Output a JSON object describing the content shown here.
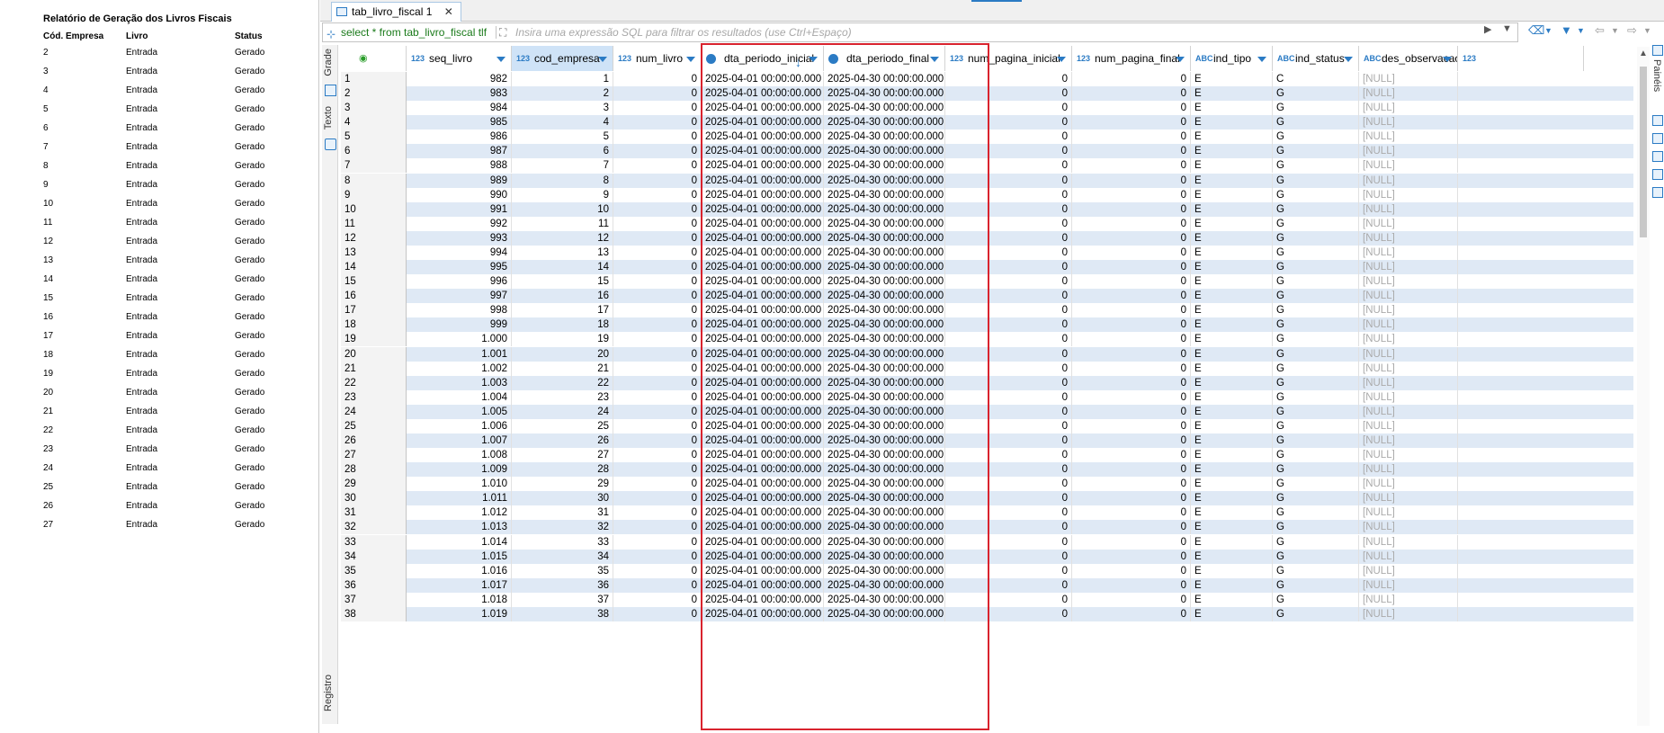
{
  "report": {
    "title": "Relatório de Geração dos Livros Fiscais",
    "headers": [
      "Cód. Empresa",
      "Livro",
      "Status"
    ],
    "rows": [
      [
        "2",
        "Entrada",
        "Gerado"
      ],
      [
        "3",
        "Entrada",
        "Gerado"
      ],
      [
        "4",
        "Entrada",
        "Gerado"
      ],
      [
        "5",
        "Entrada",
        "Gerado"
      ],
      [
        "6",
        "Entrada",
        "Gerado"
      ],
      [
        "7",
        "Entrada",
        "Gerado"
      ],
      [
        "8",
        "Entrada",
        "Gerado"
      ],
      [
        "9",
        "Entrada",
        "Gerado"
      ],
      [
        "10",
        "Entrada",
        "Gerado"
      ],
      [
        "11",
        "Entrada",
        "Gerado"
      ],
      [
        "12",
        "Entrada",
        "Gerado"
      ],
      [
        "13",
        "Entrada",
        "Gerado"
      ],
      [
        "14",
        "Entrada",
        "Gerado"
      ],
      [
        "15",
        "Entrada",
        "Gerado"
      ],
      [
        "16",
        "Entrada",
        "Gerado"
      ],
      [
        "17",
        "Entrada",
        "Gerado"
      ],
      [
        "18",
        "Entrada",
        "Gerado"
      ],
      [
        "19",
        "Entrada",
        "Gerado"
      ],
      [
        "20",
        "Entrada",
        "Gerado"
      ],
      [
        "21",
        "Entrada",
        "Gerado"
      ],
      [
        "22",
        "Entrada",
        "Gerado"
      ],
      [
        "23",
        "Entrada",
        "Gerado"
      ],
      [
        "24",
        "Entrada",
        "Gerado"
      ],
      [
        "25",
        "Entrada",
        "Gerado"
      ],
      [
        "26",
        "Entrada",
        "Gerado"
      ],
      [
        "27",
        "Entrada",
        "Gerado"
      ]
    ]
  },
  "editor": {
    "tab_label": "tab_livro_fiscal 1",
    "tab_close": "✕",
    "filter_sql": "select * from tab_livro_fiscal tlf",
    "filter_placeholder": "Insira uma expressão SQL para filtrar os resultados (use Ctrl+Espaço)",
    "side_labels": {
      "grid": "Grade",
      "text": "Texto",
      "record": "Registro"
    },
    "right_panel_label": "Painéis"
  },
  "columns": [
    {
      "name": "seq_livro",
      "type": "123"
    },
    {
      "name": "cod_empresa",
      "type": "123"
    },
    {
      "name": "num_livro",
      "type": "123"
    },
    {
      "name": "dta_periodo_inicial",
      "type": "clock"
    },
    {
      "name": "dta_periodo_final",
      "type": "clock"
    },
    {
      "name": "num_pagina_inicial",
      "type": "123"
    },
    {
      "name": "num_pagina_final",
      "type": "123"
    },
    {
      "name": "ind_tipo",
      "type": "ABC"
    },
    {
      "name": "ind_status",
      "type": "ABC"
    },
    {
      "name": "des_observacao",
      "type": "ABC"
    },
    {
      "name": "",
      "type": "123"
    }
  ],
  "rows": [
    [
      "982",
      "1",
      "0",
      "2025-04-01 00:00:00.000",
      "2025-04-30 00:00:00.000",
      "0",
      "0",
      "E",
      "C",
      "[NULL]"
    ],
    [
      "983",
      "2",
      "0",
      "2025-04-01 00:00:00.000",
      "2025-04-30 00:00:00.000",
      "0",
      "0",
      "E",
      "G",
      "[NULL]"
    ],
    [
      "984",
      "3",
      "0",
      "2025-04-01 00:00:00.000",
      "2025-04-30 00:00:00.000",
      "0",
      "0",
      "E",
      "G",
      "[NULL]"
    ],
    [
      "985",
      "4",
      "0",
      "2025-04-01 00:00:00.000",
      "2025-04-30 00:00:00.000",
      "0",
      "0",
      "E",
      "G",
      "[NULL]"
    ],
    [
      "986",
      "5",
      "0",
      "2025-04-01 00:00:00.000",
      "2025-04-30 00:00:00.000",
      "0",
      "0",
      "E",
      "G",
      "[NULL]"
    ],
    [
      "987",
      "6",
      "0",
      "2025-04-01 00:00:00.000",
      "2025-04-30 00:00:00.000",
      "0",
      "0",
      "E",
      "G",
      "[NULL]"
    ],
    [
      "988",
      "7",
      "0",
      "2025-04-01 00:00:00.000",
      "2025-04-30 00:00:00.000",
      "0",
      "0",
      "E",
      "G",
      "[NULL]"
    ],
    [
      "989",
      "8",
      "0",
      "2025-04-01 00:00:00.000",
      "2025-04-30 00:00:00.000",
      "0",
      "0",
      "E",
      "G",
      "[NULL]"
    ],
    [
      "990",
      "9",
      "0",
      "2025-04-01 00:00:00.000",
      "2025-04-30 00:00:00.000",
      "0",
      "0",
      "E",
      "G",
      "[NULL]"
    ],
    [
      "991",
      "10",
      "0",
      "2025-04-01 00:00:00.000",
      "2025-04-30 00:00:00.000",
      "0",
      "0",
      "E",
      "G",
      "[NULL]"
    ],
    [
      "992",
      "11",
      "0",
      "2025-04-01 00:00:00.000",
      "2025-04-30 00:00:00.000",
      "0",
      "0",
      "E",
      "G",
      "[NULL]"
    ],
    [
      "993",
      "12",
      "0",
      "2025-04-01 00:00:00.000",
      "2025-04-30 00:00:00.000",
      "0",
      "0",
      "E",
      "G",
      "[NULL]"
    ],
    [
      "994",
      "13",
      "0",
      "2025-04-01 00:00:00.000",
      "2025-04-30 00:00:00.000",
      "0",
      "0",
      "E",
      "G",
      "[NULL]"
    ],
    [
      "995",
      "14",
      "0",
      "2025-04-01 00:00:00.000",
      "2025-04-30 00:00:00.000",
      "0",
      "0",
      "E",
      "G",
      "[NULL]"
    ],
    [
      "996",
      "15",
      "0",
      "2025-04-01 00:00:00.000",
      "2025-04-30 00:00:00.000",
      "0",
      "0",
      "E",
      "G",
      "[NULL]"
    ],
    [
      "997",
      "16",
      "0",
      "2025-04-01 00:00:00.000",
      "2025-04-30 00:00:00.000",
      "0",
      "0",
      "E",
      "G",
      "[NULL]"
    ],
    [
      "998",
      "17",
      "0",
      "2025-04-01 00:00:00.000",
      "2025-04-30 00:00:00.000",
      "0",
      "0",
      "E",
      "G",
      "[NULL]"
    ],
    [
      "999",
      "18",
      "0",
      "2025-04-01 00:00:00.000",
      "2025-04-30 00:00:00.000",
      "0",
      "0",
      "E",
      "G",
      "[NULL]"
    ],
    [
      "1.000",
      "19",
      "0",
      "2025-04-01 00:00:00.000",
      "2025-04-30 00:00:00.000",
      "0",
      "0",
      "E",
      "G",
      "[NULL]"
    ],
    [
      "1.001",
      "20",
      "0",
      "2025-04-01 00:00:00.000",
      "2025-04-30 00:00:00.000",
      "0",
      "0",
      "E",
      "G",
      "[NULL]"
    ],
    [
      "1.002",
      "21",
      "0",
      "2025-04-01 00:00:00.000",
      "2025-04-30 00:00:00.000",
      "0",
      "0",
      "E",
      "G",
      "[NULL]"
    ],
    [
      "1.003",
      "22",
      "0",
      "2025-04-01 00:00:00.000",
      "2025-04-30 00:00:00.000",
      "0",
      "0",
      "E",
      "G",
      "[NULL]"
    ],
    [
      "1.004",
      "23",
      "0",
      "2025-04-01 00:00:00.000",
      "2025-04-30 00:00:00.000",
      "0",
      "0",
      "E",
      "G",
      "[NULL]"
    ],
    [
      "1.005",
      "24",
      "0",
      "2025-04-01 00:00:00.000",
      "2025-04-30 00:00:00.000",
      "0",
      "0",
      "E",
      "G",
      "[NULL]"
    ],
    [
      "1.006",
      "25",
      "0",
      "2025-04-01 00:00:00.000",
      "2025-04-30 00:00:00.000",
      "0",
      "0",
      "E",
      "G",
      "[NULL]"
    ],
    [
      "1.007",
      "26",
      "0",
      "2025-04-01 00:00:00.000",
      "2025-04-30 00:00:00.000",
      "0",
      "0",
      "E",
      "G",
      "[NULL]"
    ],
    [
      "1.008",
      "27",
      "0",
      "2025-04-01 00:00:00.000",
      "2025-04-30 00:00:00.000",
      "0",
      "0",
      "E",
      "G",
      "[NULL]"
    ],
    [
      "1.009",
      "28",
      "0",
      "2025-04-01 00:00:00.000",
      "2025-04-30 00:00:00.000",
      "0",
      "0",
      "E",
      "G",
      "[NULL]"
    ],
    [
      "1.010",
      "29",
      "0",
      "2025-04-01 00:00:00.000",
      "2025-04-30 00:00:00.000",
      "0",
      "0",
      "E",
      "G",
      "[NULL]"
    ],
    [
      "1.011",
      "30",
      "0",
      "2025-04-01 00:00:00.000",
      "2025-04-30 00:00:00.000",
      "0",
      "0",
      "E",
      "G",
      "[NULL]"
    ],
    [
      "1.012",
      "31",
      "0",
      "2025-04-01 00:00:00.000",
      "2025-04-30 00:00:00.000",
      "0",
      "0",
      "E",
      "G",
      "[NULL]"
    ],
    [
      "1.013",
      "32",
      "0",
      "2025-04-01 00:00:00.000",
      "2025-04-30 00:00:00.000",
      "0",
      "0",
      "E",
      "G",
      "[NULL]"
    ],
    [
      "1.014",
      "33",
      "0",
      "2025-04-01 00:00:00.000",
      "2025-04-30 00:00:00.000",
      "0",
      "0",
      "E",
      "G",
      "[NULL]"
    ],
    [
      "1.015",
      "34",
      "0",
      "2025-04-01 00:00:00.000",
      "2025-04-30 00:00:00.000",
      "0",
      "0",
      "E",
      "G",
      "[NULL]"
    ],
    [
      "1.016",
      "35",
      "0",
      "2025-04-01 00:00:00.000",
      "2025-04-30 00:00:00.000",
      "0",
      "0",
      "E",
      "G",
      "[NULL]"
    ],
    [
      "1.017",
      "36",
      "0",
      "2025-04-01 00:00:00.000",
      "2025-04-30 00:00:00.000",
      "0",
      "0",
      "E",
      "G",
      "[NULL]"
    ],
    [
      "1.018",
      "37",
      "0",
      "2025-04-01 00:00:00.000",
      "2025-04-30 00:00:00.000",
      "0",
      "0",
      "E",
      "G",
      "[NULL]"
    ],
    [
      "1.019",
      "38",
      "0",
      "2025-04-01 00:00:00.000",
      "2025-04-30 00:00:00.000",
      "0",
      "0",
      "E",
      "G",
      "[NULL]"
    ]
  ],
  "colors": {
    "accent": "#2b7bc4",
    "highlight": "#d9232e",
    "row_alt": "#dfe9f5",
    "header_selected": "#cfe3f7",
    "sql_text": "#1a7a1a"
  }
}
